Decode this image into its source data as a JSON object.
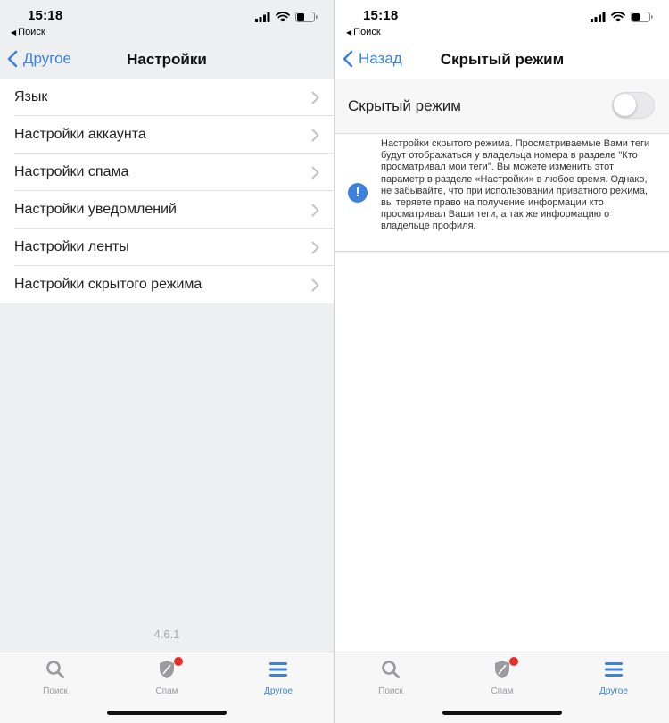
{
  "status_bar": {
    "time": "15:18",
    "back_app_label": "Поиск"
  },
  "left_screen": {
    "nav": {
      "back_label": "Другое",
      "title": "Настройки"
    },
    "settings_items": [
      {
        "label": "Язык"
      },
      {
        "label": "Настройки аккаунта"
      },
      {
        "label": "Настройки спама"
      },
      {
        "label": "Настройки уведомлений"
      },
      {
        "label": "Настройки ленты"
      },
      {
        "label": "Настройки скрытого режима"
      }
    ],
    "version": "4.6.1"
  },
  "right_screen": {
    "nav": {
      "back_label": "Назад",
      "title": "Скрытый режим"
    },
    "stealth_toggle": {
      "label": "Скрытый режим",
      "enabled": false
    },
    "info": {
      "icon": "!",
      "text": "Настройки скрытого режима. Просматриваемые Вами теги будут отображаться у владельца номера в разделе \"Кто просматривал мои теги\". Вы можете изменить этот параметр в разделе «Настройки» в любое время. Однако, не забывайте, что при использовании приватного режима, вы теряете право на получение информации кто просматривал Ваши теги, а так же информацию о владельце профиля."
    }
  },
  "tab_bar": {
    "tabs": [
      {
        "label": "Поиск",
        "icon": "search-icon",
        "active": false
      },
      {
        "label": "Спам",
        "icon": "shield-icon",
        "active": false,
        "badge": true
      },
      {
        "label": "Другое",
        "icon": "menu-icon",
        "active": true
      }
    ]
  },
  "colors": {
    "accent": "#3b82d8",
    "badge": "#e8302a",
    "list_background": "#eeeff1"
  }
}
